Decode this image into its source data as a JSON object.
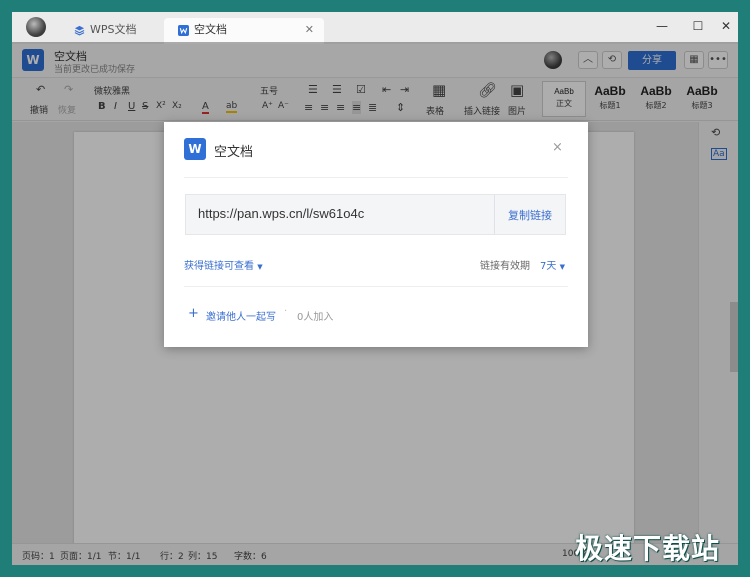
{
  "tabs": [
    {
      "label": "WPS文档"
    },
    {
      "label": "空文档"
    }
  ],
  "document": {
    "title": "空文档",
    "subtitle": "当前更改已成功保存",
    "logo_letter": "W"
  },
  "header": {
    "share_label": "分享"
  },
  "ribbon": {
    "undo_label": "撤销",
    "redo_label": "恢复",
    "font_name": "微软雅黑",
    "font_size": "五号",
    "table_label": "表格",
    "insert_link_label": "插入链接",
    "image_label": "图片",
    "styles": [
      {
        "preview": "AaBb",
        "label": "正文"
      },
      {
        "preview": "AaBb",
        "label": "标题1"
      },
      {
        "preview": "AaBb",
        "label": "标题2"
      },
      {
        "preview": "AaBb",
        "label": "标题3"
      }
    ]
  },
  "statusbar": {
    "page_num": "页码：1",
    "page": "页面：1/1",
    "section": "节：1/1",
    "row": "行：2",
    "col": "列：15",
    "words": "字数：6",
    "zoom": "100%"
  },
  "dialog": {
    "logo_letter": "W",
    "title": "空文档",
    "close": "×",
    "link_url": "https://pan.wps.cn/l/sw61o4c",
    "copy_label": "复制链接",
    "permission_label": "获得链接可查看",
    "valid_label": "链接有效期",
    "valid_value": "7天",
    "invite_label": "邀请他人一起写",
    "joined_label": "0人加入"
  },
  "watermark": "极速下载站",
  "colors": {
    "accent": "#2f6fd6",
    "link": "#3a6fcf",
    "desktop": "#1f7f78"
  }
}
